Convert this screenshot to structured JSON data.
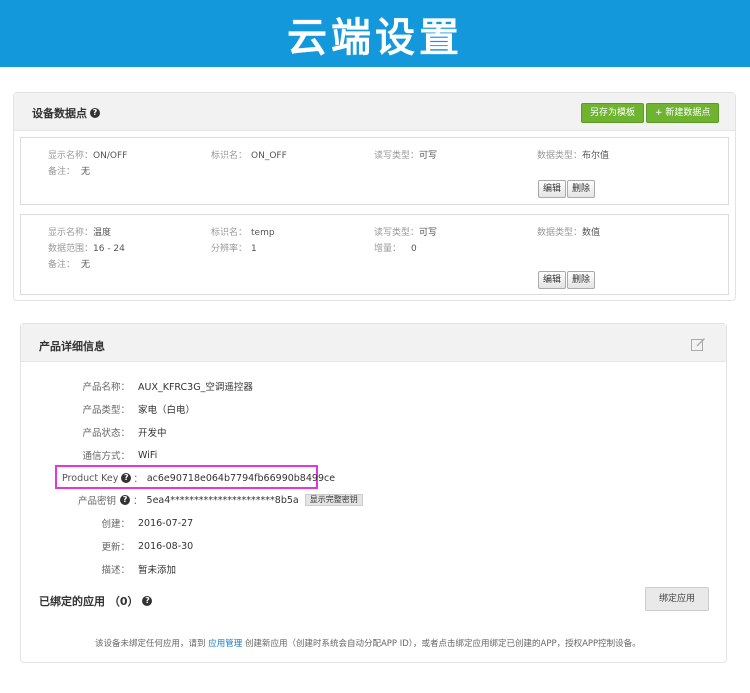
{
  "banner": {
    "title": "云端设置"
  },
  "datapoints": {
    "title": "设备数据点",
    "save_template": "另存为模板",
    "new_datapoint": "+ 新建数据点",
    "items": [
      {
        "display_name_label": "显示名称：",
        "display_name": "ON/OFF",
        "identifier_label": "标识名：",
        "identifier": "ON_OFF",
        "rw_label": "读写类型：",
        "rw": "可写",
        "type_label": "数据类型：",
        "type": "布尔值",
        "note_label": "备注：",
        "note": "无",
        "edit": "编辑",
        "delete": "删除"
      },
      {
        "display_name_label": "显示名称：",
        "display_name": "温度",
        "identifier_label": "标识名：",
        "identifier": "temp",
        "rw_label": "读写类型：",
        "rw": "可写",
        "type_label": "数据类型：",
        "type": "数值",
        "range_label": "数据范围：",
        "range": "16 - 24",
        "resolution_label": "分辨率：",
        "resolution": "1",
        "increment_label": "增量：",
        "increment": "0",
        "note_label": "备注：",
        "note": "无",
        "edit": "编辑",
        "delete": "删除"
      }
    ]
  },
  "product": {
    "title": "产品详细信息",
    "rows": [
      {
        "label": "产品名称：",
        "value": "AUX_KFRC3G_空调遥控器"
      },
      {
        "label": "产品类型：",
        "value": "家电（白电）"
      },
      {
        "label": "产品状态：",
        "value": "开发中"
      },
      {
        "label": "通信方式：",
        "value": "WiFi"
      }
    ],
    "product_key_label": "Product Key",
    "product_key_colon": "：",
    "product_key": "ac6e90718e064b7794fb66990b8499ce",
    "secret_label": "产品密钥",
    "secret_colon": "：",
    "secret": "5ea4**********************8b5a",
    "show_secret": "显示完整密钥",
    "rows2": [
      {
        "label": "创建：",
        "value": "2016-07-27"
      },
      {
        "label": "更新：",
        "value": "2016-08-30"
      },
      {
        "label": "描述：",
        "value": "暂未添加"
      }
    ]
  },
  "bound": {
    "title": "已绑定的应用 （0）",
    "bind_button": "绑定应用",
    "note_prefix": "该设备未绑定任何应用，请到",
    "note_link": "应用管理",
    "note_suffix": "创建新应用（创建时系统会自动分配APP ID），或者点击绑定应用绑定已创建的APP，授权APP控制设备。"
  },
  "colors": {
    "banner": "#1398dc",
    "green": "#6fb330",
    "highlight": "#e534e0",
    "link": "#1a7fd4"
  },
  "icons": {
    "help": "help-icon",
    "edit": "edit-icon"
  }
}
